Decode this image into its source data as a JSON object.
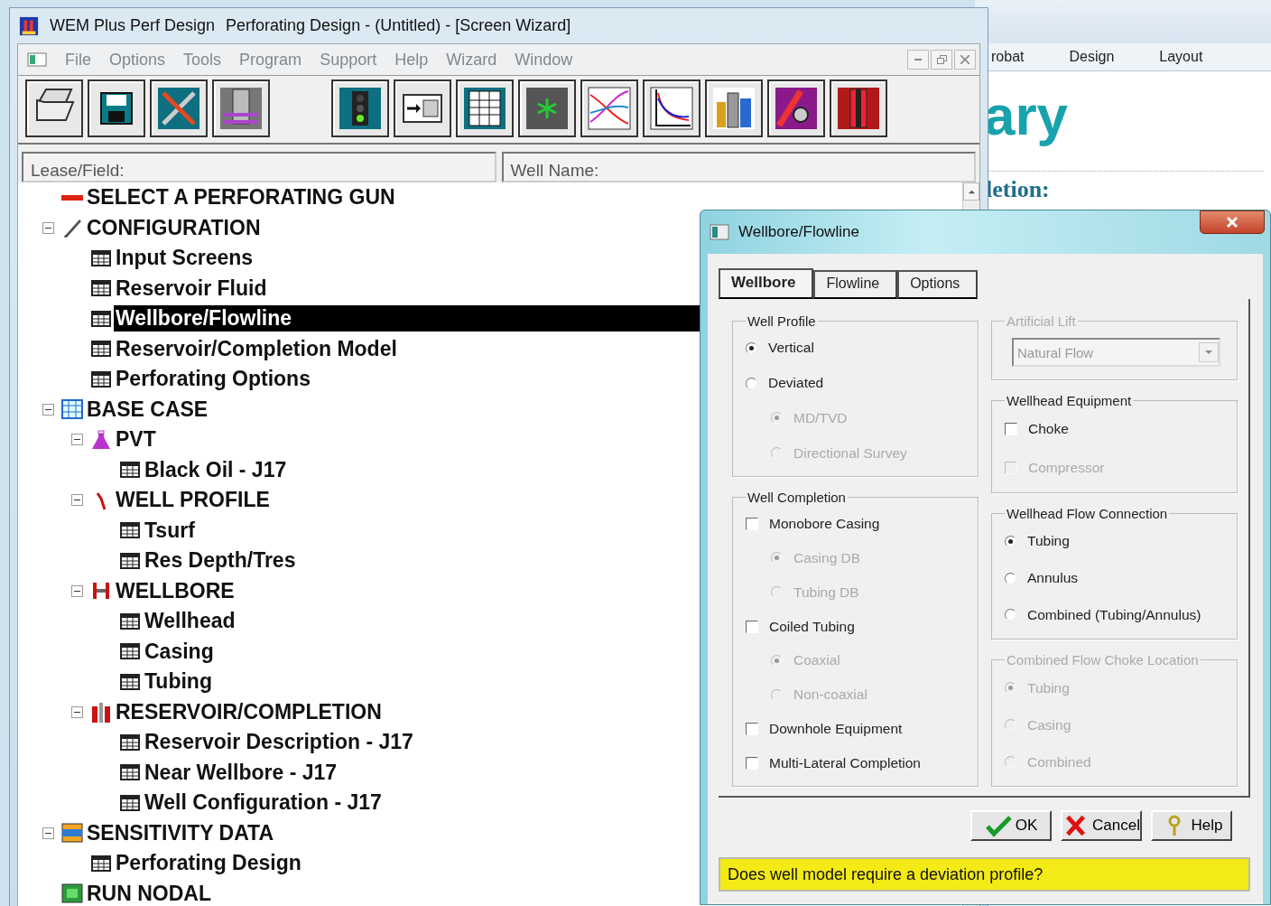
{
  "background_document": {
    "ribbon_tabs": [
      {
        "label": "robat"
      },
      {
        "label": "Design"
      },
      {
        "label": "Layout"
      }
    ],
    "heading": "ary",
    "subheading": "letion:"
  },
  "window": {
    "title": "WEM Plus Perf Design",
    "document_title": "Perforating Design - (Untitled) - [Screen Wizard]"
  },
  "menu": [
    "File",
    "Options",
    "Tools",
    "Program",
    "Support",
    "Help",
    "Wizard",
    "Window"
  ],
  "fields": [
    {
      "label": "Lease/Field:"
    },
    {
      "label": "Well Name:"
    }
  ],
  "tree": [
    {
      "label": "SELECT A PERFORATING GUN",
      "kind": "gun",
      "selected": false
    },
    {
      "label": "CONFIGURATION",
      "kind": "config",
      "selected": false,
      "expanded": true,
      "children": [
        {
          "label": "Input Screens",
          "kind": "form",
          "selected": false
        },
        {
          "label": "Reservoir Fluid",
          "kind": "form",
          "selected": false
        },
        {
          "label": "Wellbore/Flowline",
          "kind": "form",
          "selected": true
        },
        {
          "label": "Reservoir/Completion Model",
          "kind": "form",
          "selected": false
        },
        {
          "label": "Perforating Options",
          "kind": "form",
          "selected": false
        }
      ]
    },
    {
      "label": "BASE CASE",
      "kind": "basecase",
      "selected": false,
      "expanded": true,
      "children": [
        {
          "label": "PVT",
          "kind": "pvt",
          "selected": false,
          "expanded": true,
          "children": [
            {
              "label": "Black Oil - J17",
              "kind": "form",
              "selected": false
            }
          ]
        },
        {
          "label": "WELL PROFILE",
          "kind": "profile",
          "selected": false,
          "expanded": true,
          "children": [
            {
              "label": "Tsurf",
              "kind": "form",
              "selected": false
            },
            {
              "label": "Res Depth/Tres",
              "kind": "form",
              "selected": false
            }
          ]
        },
        {
          "label": "WELLBORE",
          "kind": "wellbore",
          "selected": false,
          "expanded": true,
          "children": [
            {
              "label": "Wellhead",
              "kind": "form",
              "selected": false
            },
            {
              "label": "Casing",
              "kind": "form",
              "selected": false
            },
            {
              "label": "Tubing",
              "kind": "form",
              "selected": false
            }
          ]
        },
        {
          "label": "RESERVOIR/COMPLETION",
          "kind": "reservoir",
          "selected": false,
          "expanded": true,
          "children": [
            {
              "label": "Reservoir Description - J17",
              "kind": "form",
              "selected": false
            },
            {
              "label": "Near Wellbore - J17",
              "kind": "form",
              "selected": false
            },
            {
              "label": "Well Configuration - J17",
              "kind": "form",
              "selected": false
            }
          ]
        }
      ]
    },
    {
      "label": "SENSITIVITY DATA",
      "kind": "sensitivity",
      "selected": false,
      "expanded": true,
      "children": [
        {
          "label": "Perforating Design",
          "kind": "form",
          "selected": false
        }
      ]
    },
    {
      "label": "RUN NODAL",
      "kind": "run",
      "selected": false
    }
  ],
  "dialog": {
    "title": "Wellbore/Flowline",
    "tabs": [
      {
        "label": "Wellbore",
        "selected": true
      },
      {
        "label": "Flowline",
        "selected": false
      },
      {
        "label": "Options",
        "selected": false
      }
    ],
    "columns": [
      [
        {
          "title": "Well Profile",
          "disabled": false,
          "items": [
            {
              "kind": "radio",
              "label": "Vertical",
              "selected": true,
              "disabled": false
            },
            {
              "kind": "radio",
              "label": "Deviated",
              "selected": false,
              "disabled": false,
              "children": [
                {
                  "kind": "radio",
                  "label": "MD/TVD",
                  "selected": true,
                  "disabled": true
                },
                {
                  "kind": "radio",
                  "label": "Directional Survey",
                  "selected": false,
                  "disabled": true
                }
              ]
            }
          ]
        },
        {
          "title": "Well Completion",
          "disabled": false,
          "items": [
            {
              "kind": "checkbox",
              "label": "Monobore Casing",
              "checked": false,
              "disabled": false,
              "children": [
                {
                  "kind": "radio",
                  "label": "Casing DB",
                  "selected": true,
                  "disabled": true
                },
                {
                  "kind": "radio",
                  "label": "Tubing DB",
                  "selected": false,
                  "disabled": true
                }
              ]
            },
            {
              "kind": "checkbox",
              "label": "Coiled Tubing",
              "checked": false,
              "disabled": false,
              "children": [
                {
                  "kind": "radio",
                  "label": "Coaxial",
                  "selected": true,
                  "disabled": true
                },
                {
                  "kind": "radio",
                  "label": "Non-coaxial",
                  "selected": false,
                  "disabled": true
                }
              ]
            },
            {
              "kind": "checkbox",
              "label": "Downhole Equipment",
              "checked": false,
              "disabled": false
            },
            {
              "kind": "checkbox",
              "label": "Multi-Lateral Completion",
              "checked": false,
              "disabled": false
            }
          ]
        }
      ],
      [
        {
          "title": "Artificial Lift",
          "disabled": true,
          "items": [
            {
              "kind": "dropdown",
              "value": "Natural Flow",
              "disabled": true
            }
          ]
        },
        {
          "title": "Wellhead Equipment",
          "disabled": false,
          "items": [
            {
              "kind": "checkbox",
              "label": "Choke",
              "checked": false,
              "disabled": false
            },
            {
              "kind": "checkbox",
              "label": "Compressor",
              "checked": false,
              "disabled": true
            }
          ]
        },
        {
          "title": "Wellhead Flow Connection",
          "disabled": false,
          "items": [
            {
              "kind": "radio",
              "label": "Tubing",
              "selected": true,
              "disabled": false
            },
            {
              "kind": "radio",
              "label": "Annulus",
              "selected": false,
              "disabled": false
            },
            {
              "kind": "radio",
              "label": "Combined (Tubing/Annulus)",
              "selected": false,
              "disabled": false
            }
          ]
        },
        {
          "title": "Combined Flow Choke Location",
          "disabled": true,
          "items": [
            {
              "kind": "radio",
              "label": "Tubing",
              "selected": true,
              "disabled": true
            },
            {
              "kind": "radio",
              "label": "Casing",
              "selected": false,
              "disabled": true
            },
            {
              "kind": "radio",
              "label": "Combined",
              "selected": false,
              "disabled": true
            }
          ]
        }
      ]
    ],
    "buttons": [
      {
        "kind": "ok",
        "label": "OK"
      },
      {
        "kind": "cancel",
        "label": "Cancel"
      },
      {
        "kind": "help",
        "label": "Help"
      }
    ],
    "status": "Does well model require a deviation profile?"
  }
}
